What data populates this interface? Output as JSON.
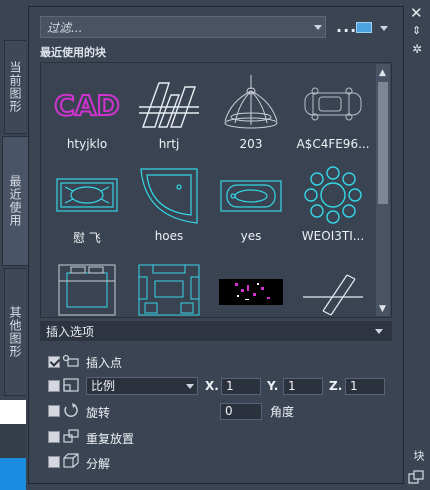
{
  "side_tabs": [
    {
      "label": "当前图形"
    },
    {
      "label": "最近使用"
    },
    {
      "label": "其他图形"
    }
  ],
  "toolbar": {
    "filter_placeholder": "过滤...",
    "more_label": "..."
  },
  "section_title": "最近使用的块",
  "blocks": [
    {
      "name": "htyjklo",
      "icon": "cad-logo-thumbnail"
    },
    {
      "name": "hrtj",
      "icon": "striped-logo-thumbnail"
    },
    {
      "name": "203",
      "icon": "chandelier-thumbnail"
    },
    {
      "name": "A$C4FE96...",
      "icon": "car-thumbnail"
    },
    {
      "name": "慰 飞",
      "icon": "rug-thumbnail"
    },
    {
      "name": "hoes",
      "icon": "corner-bathtub-thumbnail"
    },
    {
      "name": "yes",
      "icon": "bathtub-thumbnail"
    },
    {
      "name": "WEOI3TI...",
      "icon": "round-table-thumbnail"
    },
    {
      "name": "",
      "icon": "bed-thumbnail"
    },
    {
      "name": "",
      "icon": "sofa-set-thumbnail"
    },
    {
      "name": "",
      "icon": "drawing-thumbnail"
    },
    {
      "name": "",
      "icon": "pipe-thumbnail"
    }
  ],
  "insert_options": {
    "title": "插入选项",
    "insertion_point": {
      "label": "插入点",
      "checked": true
    },
    "scale": {
      "mode": "比例",
      "x_label": "X.",
      "x": "1",
      "y_label": "Y.",
      "y": "1",
      "z_label": "Z.",
      "z": "1",
      "checked": false
    },
    "rotation": {
      "label": "旋转",
      "value": "0",
      "unit_label": "角度",
      "checked": false
    },
    "repeat": {
      "label": "重复放置",
      "checked": false
    },
    "explode": {
      "label": "分解",
      "checked": false
    }
  },
  "palette_title": "块",
  "colors": {
    "accent_cyan": "#35d6e6",
    "magenta": "#d033d0",
    "panel": "#3b4453"
  }
}
